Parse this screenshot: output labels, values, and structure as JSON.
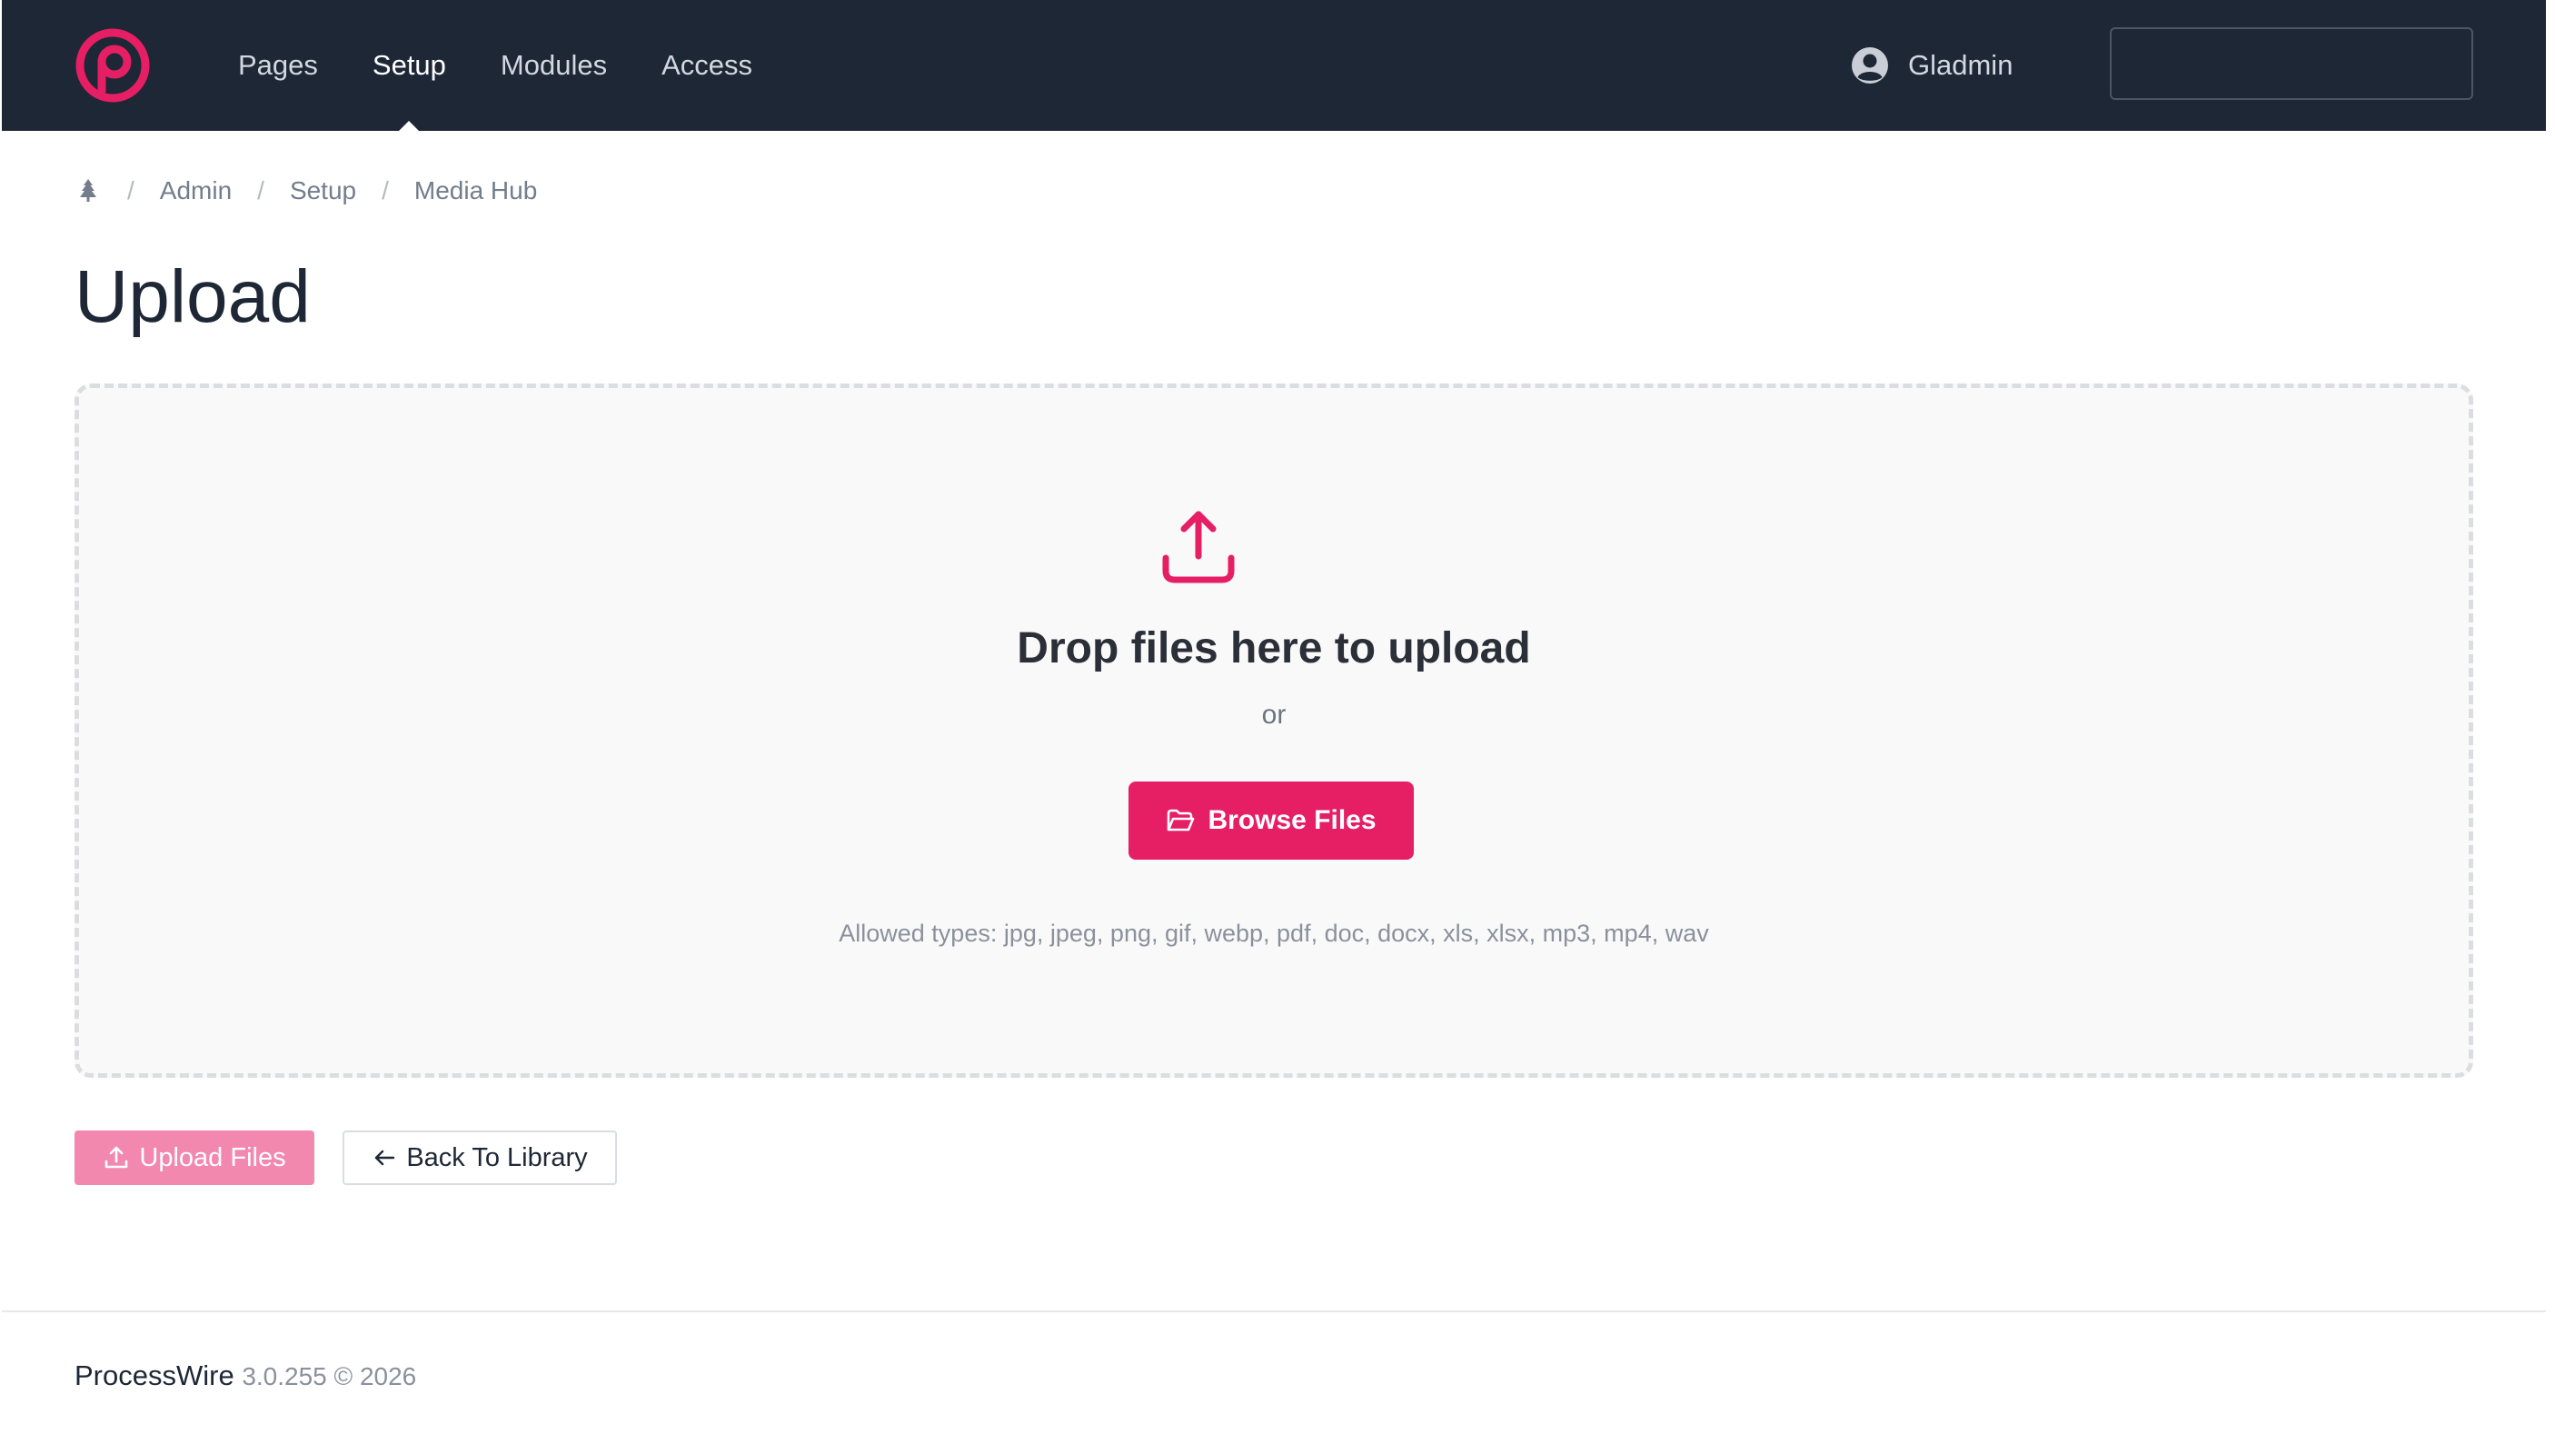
{
  "app": {
    "colors": {
      "topbar": "#1e2736",
      "accent": "#e61e64",
      "accent_disabled": "#f288ad"
    }
  },
  "nav": {
    "items": [
      {
        "label": "Pages",
        "active": false
      },
      {
        "label": "Setup",
        "active": true
      },
      {
        "label": "Modules",
        "active": false
      },
      {
        "label": "Access",
        "active": false
      }
    ]
  },
  "user": {
    "name": "Gladmin",
    "icon": "user-circle-icon"
  },
  "search": {
    "placeholder": "",
    "icon": "search-icon"
  },
  "breadcrumb": {
    "home_icon": "tree-icon",
    "items": [
      "Admin",
      "Setup",
      "Media Hub"
    ]
  },
  "page": {
    "title": "Upload"
  },
  "dropzone": {
    "icon": "upload-icon",
    "title": "Drop files here to upload",
    "or": "or",
    "browse_label": "Browse Files",
    "allowed_types": "Allowed types: jpg, jpeg, png, gif, webp, pdf, doc, docx, xls, xlsx, mp3, mp4, wav"
  },
  "actions": {
    "upload_label": "Upload Files",
    "back_label": "Back To Library"
  },
  "footer": {
    "brand": "ProcessWire",
    "meta": "3.0.255 © 2026"
  }
}
